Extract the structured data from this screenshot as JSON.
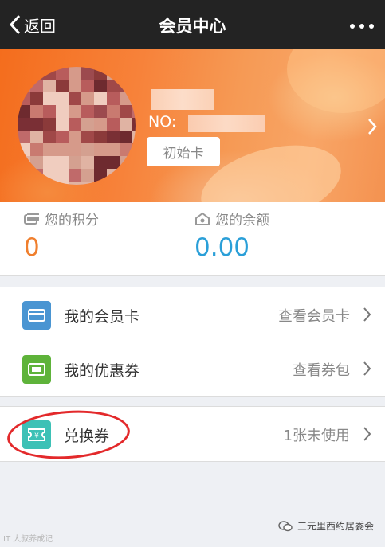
{
  "header": {
    "back_label": "返回",
    "title": "会员中心",
    "more_icon": "more-dots-icon"
  },
  "member": {
    "no_label": "NO:",
    "card_type": "初始卡"
  },
  "stats": {
    "points": {
      "label": "您的积分",
      "value": "0",
      "icon": "points-card-icon",
      "color": "#f07f2e"
    },
    "balance": {
      "label": "您的余额",
      "value": "0.00",
      "icon": "wallet-icon",
      "color": "#2a9fd8"
    }
  },
  "menu": [
    {
      "label": "我的会员卡",
      "action": "查看会员卡",
      "icon": "member-card-icon",
      "icon_color": "#4a95d2"
    },
    {
      "label": "我的优惠券",
      "action": "查看券包",
      "icon": "coupon-icon",
      "icon_color": "#5eb33a"
    }
  ],
  "exchange": {
    "label": "兑换券",
    "action": "1张未使用",
    "icon": "voucher-icon",
    "icon_color": "#3dc1b6"
  },
  "watermark": {
    "left": "IT 大叔养成记",
    "right": "三元里西约居委会"
  }
}
